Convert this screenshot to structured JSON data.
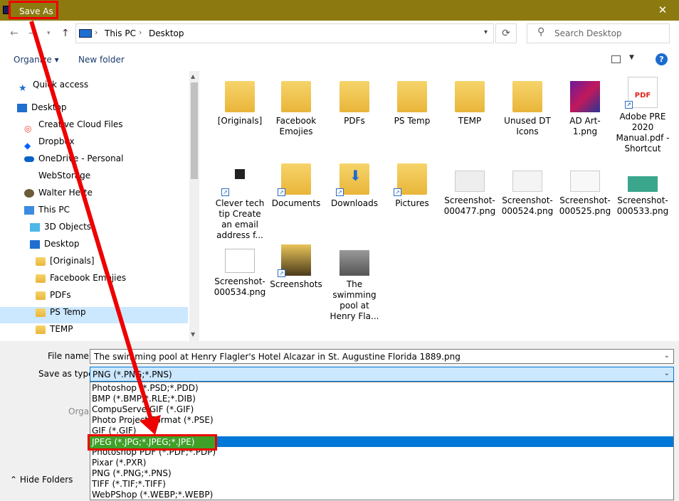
{
  "window": {
    "title": "Save As",
    "close_glyph": "✕"
  },
  "address": {
    "crumbs": [
      "This PC",
      "Desktop"
    ],
    "search_placeholder": "Search Desktop"
  },
  "toolbar": {
    "organize": "Organize ▾",
    "new_folder": "New folder",
    "help": "?"
  },
  "nav": {
    "items": [
      {
        "label": "Quick access",
        "icon": "star-icon"
      },
      {
        "label": "Desktop",
        "icon": "desktop-icon"
      },
      {
        "label": "Creative Cloud Files",
        "icon": "creative-cloud-icon"
      },
      {
        "label": "Dropbox",
        "icon": "dropbox-icon"
      },
      {
        "label": "OneDrive - Personal",
        "icon": "onedrive-icon"
      },
      {
        "label": "WebStorage",
        "icon": "folder-icon"
      },
      {
        "label": "Walter Hette",
        "icon": "user-icon"
      },
      {
        "label": "This PC",
        "icon": "computer-icon"
      },
      {
        "label": "3D Objects",
        "icon": "cube-icon"
      },
      {
        "label": "Desktop",
        "icon": "desktop-icon"
      },
      {
        "label": "[Originals]",
        "icon": "folder-icon"
      },
      {
        "label": "Facebook Emojies",
        "icon": "folder-icon"
      },
      {
        "label": "PDFs",
        "icon": "folder-icon"
      },
      {
        "label": "PS Temp",
        "icon": "folder-icon"
      },
      {
        "label": "TEMP",
        "icon": "folder-icon"
      }
    ]
  },
  "files": [
    {
      "name": "[Originals]",
      "kind": "folder"
    },
    {
      "name": "Facebook Emojies",
      "kind": "folder"
    },
    {
      "name": "PDFs",
      "kind": "folder"
    },
    {
      "name": "PS Temp",
      "kind": "folder"
    },
    {
      "name": "TEMP",
      "kind": "folder"
    },
    {
      "name": "Unused DT Icons",
      "kind": "folder"
    },
    {
      "name": "AD Art-1.png",
      "kind": "image"
    },
    {
      "name": "Adobe PRE 2020 Manual.pdf - Shortcut",
      "kind": "pdf"
    },
    {
      "name": "Clever tech tip Create an email address f...",
      "kind": "shortcut"
    },
    {
      "name": "Documents",
      "kind": "folder"
    },
    {
      "name": "Downloads",
      "kind": "folder"
    },
    {
      "name": "Pictures",
      "kind": "folder"
    },
    {
      "name": "Screenshot-000477.png",
      "kind": "image"
    },
    {
      "name": "Screenshot-000524.png",
      "kind": "image"
    },
    {
      "name": "Screenshot-000525.png",
      "kind": "image"
    },
    {
      "name": "Screenshot-000533.png",
      "kind": "image"
    },
    {
      "name": "Screenshot-000534.png",
      "kind": "image"
    },
    {
      "name": "Screenshots",
      "kind": "folder"
    },
    {
      "name": "The swimming pool at Henry Fla...",
      "kind": "image"
    }
  ],
  "form": {
    "file_name_label": "File name:",
    "file_name_value": "The swimming pool at Henry Flagler's Hotel Alcazar in St. Augustine Florida 1889.png",
    "save_type_label": "Save as type:",
    "save_type_value": "PNG (*.PNG;*.PNS)",
    "organize_partial": "Orga",
    "hide_folders": "Hide Folders",
    "type_options": [
      "Photoshop (*.PSD;*.PDD)",
      "BMP (*.BMP;*.RLE;*.DIB)",
      "CompuServe GIF (*.GIF)",
      "Photo Project Format (*.PSE)",
      "GIF (*.GIF)",
      "JPEG (*.JPG;*.JPEG;*.JPE)",
      "Photoshop PDF (*.PDF;*.PDP)",
      "Pixar (*.PXR)",
      "PNG (*.PNG;*.PNS)",
      "TIFF (*.TIF;*.TIFF)",
      "WebPShop (*.WEBP;*.WEBP)"
    ],
    "highlighted_option": "JPEG (*.JPG;*.JPEG;*.JPE)"
  },
  "colors": {
    "title_bg": "#8c7a10",
    "annotation": "#e00000",
    "selection": "#0078d7"
  }
}
